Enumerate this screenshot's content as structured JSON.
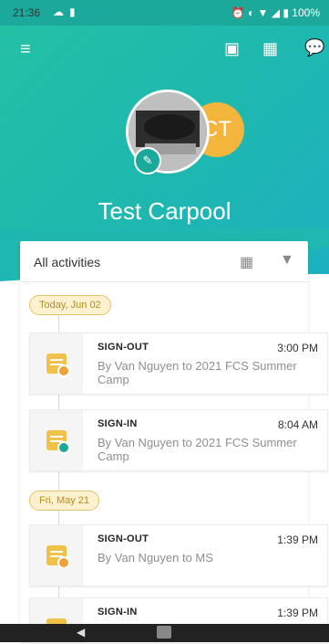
{
  "status_bar": {
    "time": "21:36",
    "battery": "100%"
  },
  "header": {
    "title": "Test Carpool",
    "avatar_initials": "CT"
  },
  "card": {
    "title": "All activities"
  },
  "timeline": [
    {
      "date": "Today, Jun 02"
    },
    {
      "type": "SIGN-OUT",
      "time": "3:00 PM",
      "desc": "By Van Nguyen to 2021 FCS Summer Camp",
      "badge_color": "#f0a23a"
    },
    {
      "type": "SIGN-IN",
      "time": "8:04 AM",
      "desc": "By Van Nguyen to 2021 FCS Summer Camp",
      "badge_color": "#1aa99a"
    },
    {
      "date": "Fri, May 21"
    },
    {
      "type": "SIGN-OUT",
      "time": "1:39 PM",
      "desc": "By Van Nguyen to MS",
      "badge_color": "#f0a23a"
    },
    {
      "type": "SIGN-IN",
      "time": "1:39 PM",
      "desc": "",
      "badge_color": "#1aa99a"
    }
  ],
  "colors": {
    "accent": "#1aa99a",
    "avatar_bg": "#f3b53b",
    "pill_bg": "#fdf1cf"
  }
}
